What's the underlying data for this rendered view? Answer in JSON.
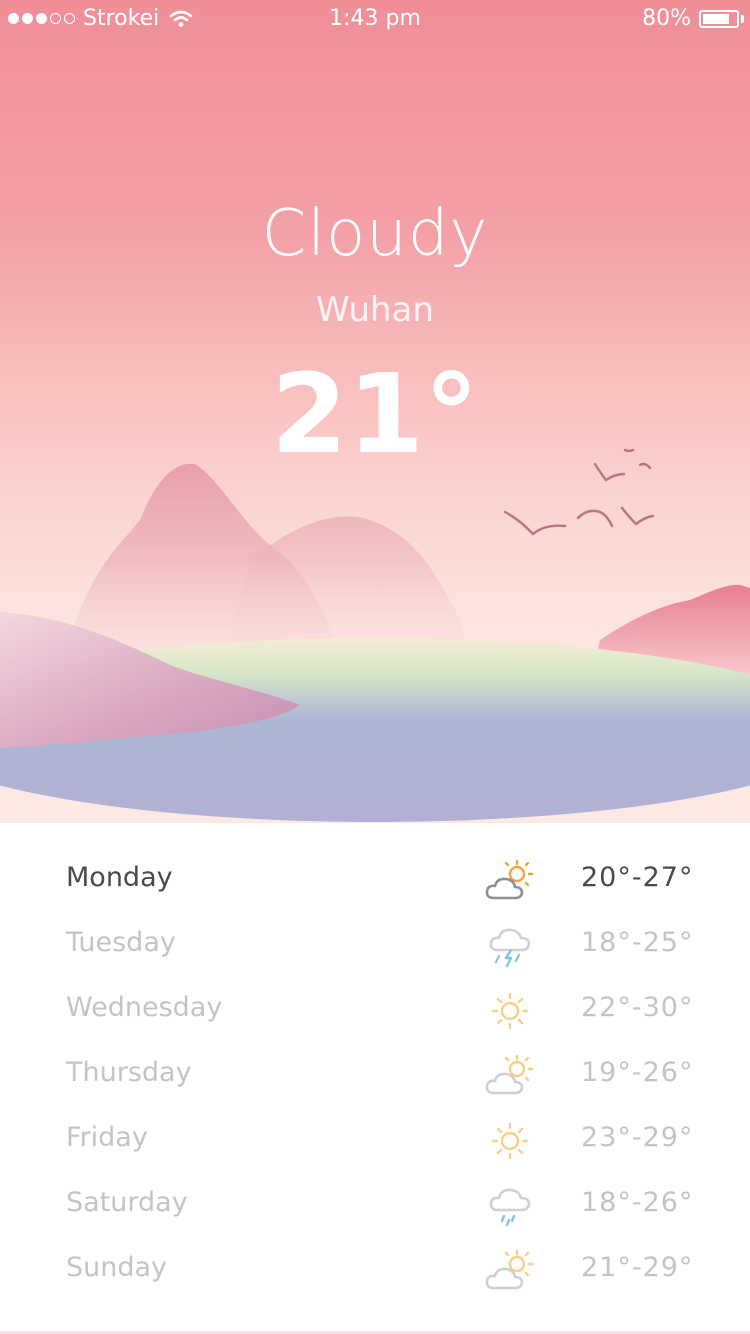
{
  "status_bar": {
    "carrier": "Strokei",
    "signal_strength": 3,
    "time": "1:43 pm",
    "battery": "80%",
    "battery_level": 0.8
  },
  "current": {
    "condition": "Cloudy",
    "city": "Wuhan",
    "temperature": "21°"
  },
  "colors": {
    "sky_top": "#f08e98",
    "sky_bottom": "#fde9e4",
    "active_text": "#4a4a4a",
    "inactive_text": "#c4c4c4"
  },
  "forecast": [
    {
      "day": "Monday",
      "range": "20°-27°",
      "icon": "partly-cloudy-icon",
      "active": true
    },
    {
      "day": "Tuesday",
      "range": "18°-25°",
      "icon": "thunderstorm-icon",
      "active": false
    },
    {
      "day": "Wednesday",
      "range": "22°-30°",
      "icon": "sunny-icon",
      "active": false
    },
    {
      "day": "Thursday",
      "range": "19°-26°",
      "icon": "partly-cloudy-icon",
      "active": false
    },
    {
      "day": "Friday",
      "range": "23°-29°",
      "icon": "sunny-icon",
      "active": false
    },
    {
      "day": "Saturday",
      "range": "18°-26°",
      "icon": "rain-icon",
      "active": false
    },
    {
      "day": "Sunday",
      "range": "21°-29°",
      "icon": "partly-cloudy-icon",
      "active": false
    }
  ]
}
